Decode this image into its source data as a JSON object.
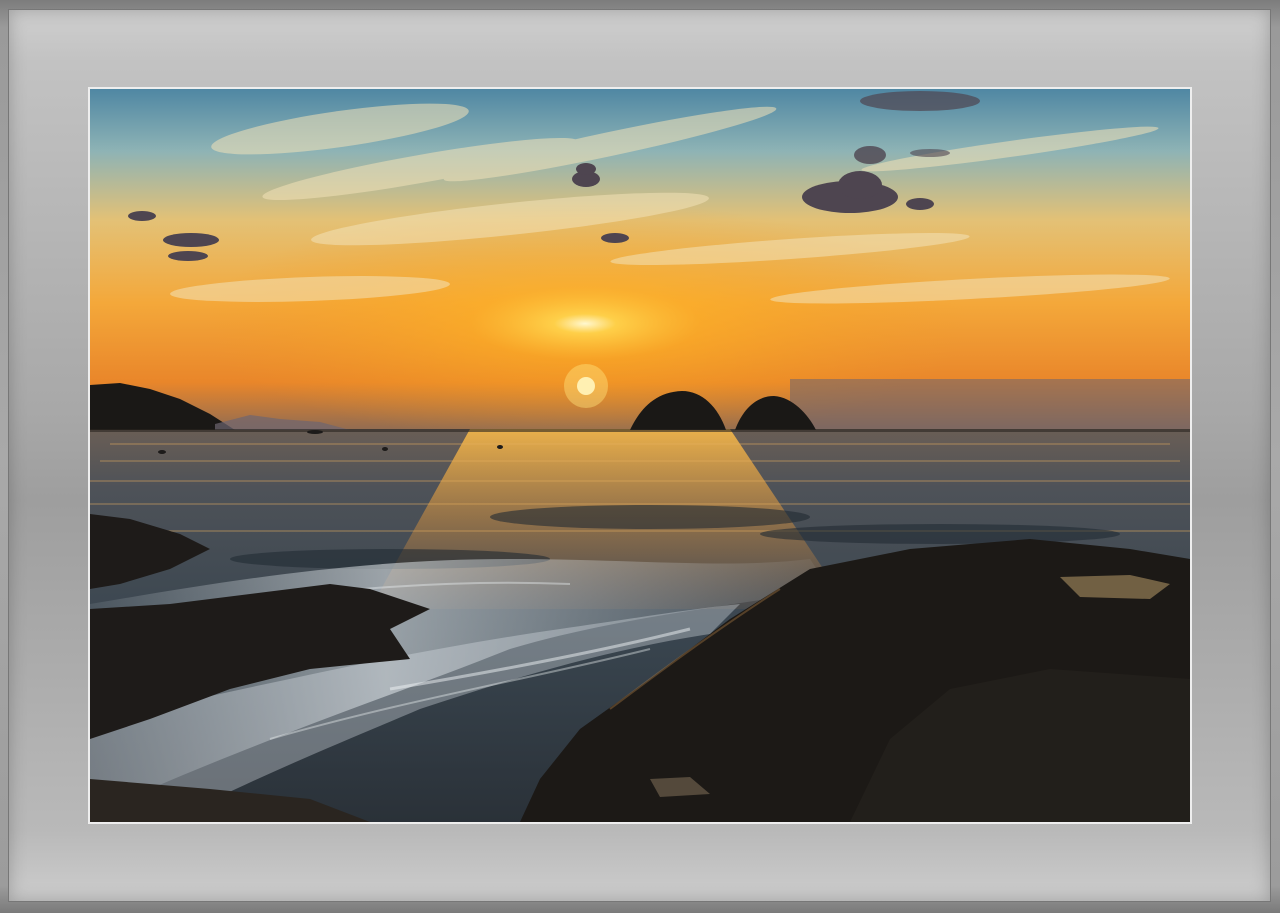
{
  "frame": {
    "outer_color": "#8a8a8a",
    "mat_color": "#b5b5b5",
    "border_color": "#eeeeee"
  },
  "photo": {
    "scene": "sunset-over-sea",
    "colors": {
      "sky_top": "#5f8fa6",
      "sky_mid": "#e6b35a",
      "sky_low": "#f29a22",
      "sun": "#fff6c8",
      "sea": "#3a4a55",
      "rocks": "#1e1b19",
      "islands": "#1a1816"
    }
  }
}
